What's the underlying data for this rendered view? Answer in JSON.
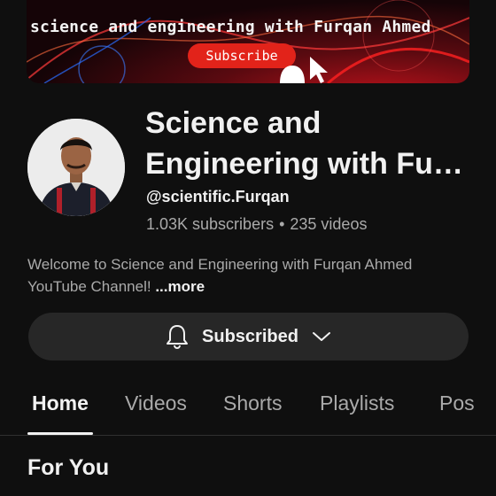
{
  "banner": {
    "title": "science and engineering  with Furqan Ahmed",
    "subscribe_label": "Subscribe",
    "accent": "#e2231a"
  },
  "channel": {
    "name": "Science and Engineering with Fur...",
    "name_line1": "Science and",
    "name_line2": "Engineering with Fur...",
    "handle": "@scientific.Furqan",
    "subscribers": "1.03K subscribers",
    "separator": "•",
    "videos": "235 videos",
    "description": "Welcome to  Science and Engineering with  Furqan Ahmed YouTube Channel! ",
    "more_label": "...more"
  },
  "subscribe_button": {
    "label": "Subscribed",
    "icon": "bell-icon",
    "dropdown_icon": "chevron-down-icon"
  },
  "tabs": [
    {
      "label": "Home",
      "active": true
    },
    {
      "label": "Videos",
      "active": false
    },
    {
      "label": "Shorts",
      "active": false
    },
    {
      "label": "Playlists",
      "active": false
    },
    {
      "label": "Pos",
      "active": false
    }
  ],
  "section": {
    "title": "For You"
  }
}
